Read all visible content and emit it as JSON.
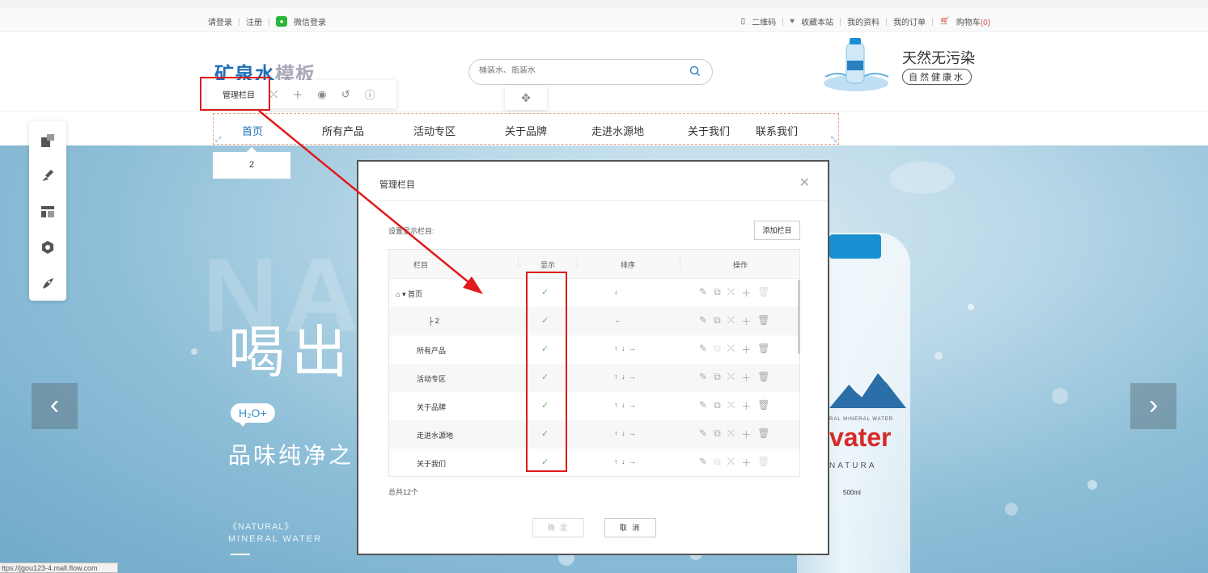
{
  "topbar": {
    "login": "请登录",
    "register": "注册",
    "wechat_login": "微信登录",
    "qrcode": "二维码",
    "favorite": "收藏本站",
    "my_profile": "我的资料",
    "my_orders": "我的订单",
    "cart": "购物车",
    "cart_count": "(0)"
  },
  "header": {
    "logo_main": "矿泉水",
    "logo_sub": "模板",
    "search_placeholder": "桶装水、瓶装水",
    "slogan_main": "天然无污染",
    "slogan_sub": "自然健康水"
  },
  "edit_toolbar": {
    "manage_label": "管理栏目"
  },
  "nav": {
    "items": [
      "首页",
      "所有产品",
      "活动专区",
      "关于品牌",
      "走进水源地",
      "关于我们",
      "联系我们"
    ],
    "sub_item": "2"
  },
  "banner": {
    "watermark": "NA",
    "headline": "喝出师",
    "badge": "H₂O+",
    "tagline": "品味纯净之",
    "natural": "《NATURAL》",
    "mineral": "MINERAL  WATER",
    "bottle_brand": "vater",
    "bottle_small": "RAL MINERAL WATER",
    "bottle_natura": "NATURA",
    "bottle_ml": "500ml"
  },
  "status_url": "ttps://jgou123-4.mall.flow.com",
  "dialog": {
    "title": "管理栏目",
    "sublabel": "设置显示栏目:",
    "add_button": "添加栏目",
    "columns": [
      "栏目",
      "显示",
      "排序",
      "操作"
    ],
    "rows": [
      {
        "name": "首页",
        "sort": "↓",
        "ops_light": [
          false,
          false,
          false,
          false,
          true
        ]
      },
      {
        "name": "├ 2",
        "sort": "←",
        "ops_light": [
          false,
          false,
          false,
          false,
          false
        ]
      },
      {
        "name": "所有产品",
        "sort": "↑ ↓ →",
        "ops_light": [
          false,
          true,
          false,
          false,
          false
        ]
      },
      {
        "name": "活动专区",
        "sort": "↑ ↓ →",
        "ops_light": [
          false,
          false,
          false,
          false,
          false
        ]
      },
      {
        "name": "关于品牌",
        "sort": "↑ ↓ →",
        "ops_light": [
          false,
          false,
          false,
          false,
          false
        ]
      },
      {
        "name": "走进水源地",
        "sort": "↑ ↓ →",
        "ops_light": [
          false,
          false,
          false,
          false,
          false
        ]
      },
      {
        "name": "关于我们",
        "sort": "↑ ↓ →",
        "ops_light": [
          false,
          true,
          false,
          false,
          true
        ]
      }
    ],
    "total": "总共12个",
    "ok_button": "确 定",
    "cancel_button": "取 消"
  },
  "colors": {
    "brand_blue": "#1e6fb8",
    "annotation_red": "#e01b1b",
    "check_green": "#5cb85c"
  }
}
